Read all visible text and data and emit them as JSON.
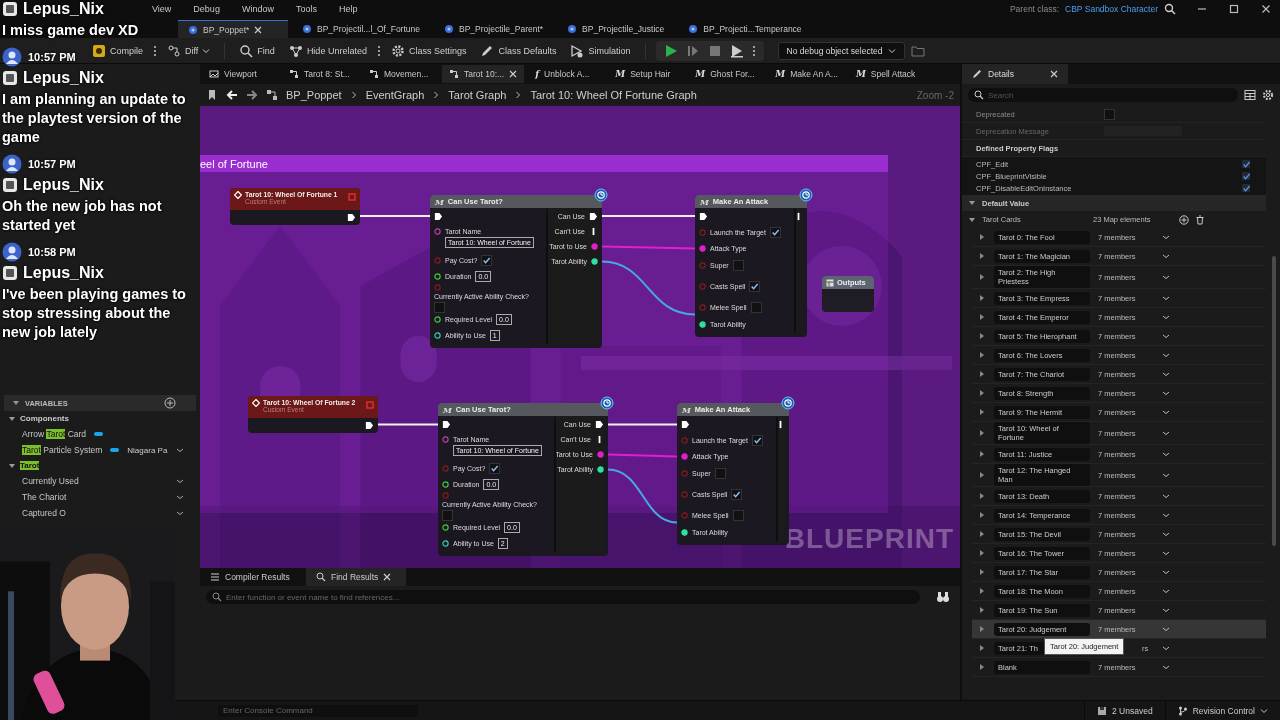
{
  "menu": {
    "items": [
      "View",
      "Debug",
      "Window",
      "Tools",
      "Help"
    ],
    "parent_class_label": "Parent class:",
    "parent_class": "CBP Sandbox Character"
  },
  "doc_tabs": [
    {
      "label": "BP_Poppet*",
      "selected": true
    },
    {
      "label": "BP_Projectil...l_Of_Fortune",
      "selected": false
    },
    {
      "label": "BP_Projectile_Parent*",
      "selected": false
    },
    {
      "label": "BP_Projectile_Justice",
      "selected": false
    },
    {
      "label": "BP_Projecti...Temperance",
      "selected": false
    }
  ],
  "toolbar": {
    "items": [
      "Compile",
      "Diff",
      "Find",
      "Hide Unrelated",
      "Class Settings",
      "Class Defaults",
      "Simulation"
    ],
    "debug_object": "No debug object selected"
  },
  "graph_tabs": [
    {
      "label": "Viewport",
      "selected": false
    },
    {
      "label": "Tarot 8: St...",
      "selected": false
    },
    {
      "label": "Movemen...",
      "selected": false
    },
    {
      "label": "Tarot 10:...",
      "selected": true
    },
    {
      "label": "Unblock A...",
      "glyph": "f",
      "selected": false
    },
    {
      "label": "Setup Hair",
      "glyph": "M",
      "selected": false
    },
    {
      "label": "Ghost For...",
      "glyph": "M",
      "selected": false
    },
    {
      "label": "Make An A...",
      "glyph": "M",
      "selected": false
    },
    {
      "label": "Spell Attack",
      "glyph": "M",
      "selected": false
    }
  ],
  "breadcrumb": [
    "BP_Poppet",
    "EventGraph",
    "Tarot Graph",
    "Tarot 10: Wheel Of Fortune Graph"
  ],
  "zoom": "Zoom -2",
  "graph": {
    "comment_title": "eel of Fortune",
    "label": "BLUEPRINT",
    "nodes": [
      {
        "kind": "event",
        "title": "Tarot 10: Wheel Of Fortune 1",
        "subtitle": "Custom Event",
        "outputs": [
          {
            "kind": "exec",
            "linked": true
          }
        ]
      },
      {
        "kind": "function",
        "glyph": "M",
        "title": "Can Use Tarot?",
        "inputs": [
          {
            "kind": "exec",
            "linked": true
          },
          {
            "kind": "name",
            "label": "Tarot Name",
            "value": "Tarot 10: Wheel of Fortune",
            "linked": false
          },
          {
            "kind": "bool",
            "label": "Pay Cost?",
            "checked": true,
            "linked": false
          },
          {
            "kind": "float",
            "label": "Duration",
            "value": "0.0",
            "linked": false
          },
          {
            "kind": "bool",
            "label": "Currently Active Ability Check?",
            "checked": false,
            "linked": false
          },
          {
            "kind": "float",
            "label": "Required Level",
            "value": "0.0",
            "linked": false
          },
          {
            "kind": "int",
            "label": "Ability to Use",
            "value": "1",
            "linked": false
          }
        ],
        "outputs": [
          {
            "kind": "exec",
            "label": "Can Use",
            "linked": true
          },
          {
            "kind": "exec",
            "label": "Can't Use",
            "linked": false
          },
          {
            "kind": "enum",
            "label": "Tarot to Use",
            "linked": true
          },
          {
            "kind": "struct",
            "label": "Tarot Ability",
            "linked": true
          }
        ]
      },
      {
        "kind": "function",
        "glyph": "M",
        "title": "Make An Attack",
        "inputs": [
          {
            "kind": "exec",
            "linked": true
          },
          {
            "kind": "bool",
            "label": "Launch the Target",
            "checked": true,
            "linked": false
          },
          {
            "kind": "enum",
            "label": "Attack Type",
            "linked": true
          },
          {
            "kind": "bool",
            "label": "Super",
            "checked": false,
            "linked": false
          },
          {
            "kind": "bool",
            "label": "Casts Spell",
            "checked": true,
            "linked": false
          },
          {
            "kind": "bool",
            "label": "Melee Spell",
            "checked": false,
            "linked": false
          },
          {
            "kind": "struct",
            "label": "Tarot Ability",
            "linked": true
          }
        ],
        "outputs": [
          {
            "kind": "exec",
            "linked": false
          }
        ]
      },
      {
        "kind": "outputs",
        "title": "Outputs"
      },
      {
        "kind": "event",
        "title": "Tarot 10: Wheel Of Fortune 2",
        "subtitle": "Custom Event",
        "outputs": [
          {
            "kind": "exec",
            "linked": true
          }
        ]
      },
      {
        "kind": "function",
        "glyph": "M",
        "title": "Can Use Tarot?",
        "inputs": [
          {
            "kind": "exec",
            "linked": true
          },
          {
            "kind": "name",
            "label": "Tarot Name",
            "value": "Tarot 10: Wheel of Fortune",
            "linked": false
          },
          {
            "kind": "bool",
            "label": "Pay Cost?",
            "checked": true,
            "linked": false
          },
          {
            "kind": "float",
            "label": "Duration",
            "value": "0.0",
            "linked": false
          },
          {
            "kind": "bool",
            "label": "Currently Active Ability Check?",
            "checked": false,
            "linked": false
          },
          {
            "kind": "float",
            "label": "Required Level",
            "value": "0.0",
            "linked": false
          },
          {
            "kind": "int",
            "label": "Ability to Use",
            "value": "2",
            "linked": false
          }
        ],
        "outputs": [
          {
            "kind": "exec",
            "label": "Can Use",
            "linked": true
          },
          {
            "kind": "exec",
            "label": "Can't Use",
            "linked": false
          },
          {
            "kind": "enum",
            "label": "Tarot to Use",
            "linked": true
          },
          {
            "kind": "struct",
            "label": "Tarot Ability",
            "linked": true
          }
        ]
      },
      {
        "kind": "function",
        "glyph": "M",
        "title": "Make An Attack",
        "inputs": [
          {
            "kind": "exec",
            "linked": true
          },
          {
            "kind": "bool",
            "label": "Launch the Target",
            "checked": true,
            "linked": false
          },
          {
            "kind": "enum",
            "label": "Attack Type",
            "linked": true
          },
          {
            "kind": "bool",
            "label": "Super",
            "checked": false,
            "linked": false
          },
          {
            "kind": "bool",
            "label": "Casts Spell",
            "checked": true,
            "linked": false
          },
          {
            "kind": "bool",
            "label": "Melee Spell",
            "checked": false,
            "linked": false
          },
          {
            "kind": "struct",
            "label": "Tarot Ability",
            "linked": true
          }
        ],
        "outputs": [
          {
            "kind": "exec",
            "linked": false
          }
        ]
      }
    ]
  },
  "bottom_panel": {
    "tabs": [
      {
        "label": "Compiler Results",
        "selected": false
      },
      {
        "label": "Find Results",
        "selected": true
      }
    ],
    "search_placeholder": "Enter function or event name to find references..."
  },
  "console_placeholder": "Enter Console Command",
  "status": {
    "unsaved": "2 Unsaved",
    "revision": "Revision Control"
  },
  "chat": [
    {
      "name": "Lepus_Nix",
      "text": "I miss game dev XD"
    },
    {
      "time": "10:57 PM",
      "name": "Lepus_Nix",
      "text": "I am planning an update to the playtest version of the game"
    },
    {
      "time": "10:57 PM",
      "name": "Lepus_Nix",
      "text": "Oh the new job has not started yet"
    },
    {
      "time": "10:58 PM",
      "name": "Lepus_Nix",
      "text": "I've been playing games to stop stressing about the new job lately"
    }
  ],
  "variables": {
    "header": "VARIABLES",
    "categories": [
      {
        "parts": [
          {
            "text": "Components",
            "match": false
          }
        ],
        "items": [
          {
            "kind": "component",
            "parts": [
              {
                "text": "Arrow ",
                "match": false
              },
              {
                "text": "Tarot",
                "match": true
              },
              {
                "text": " Card",
                "match": false
              }
            ]
          },
          {
            "kind": "component",
            "parts": [
              {
                "text": "Tarot",
                "match": true
              },
              {
                "text": " Particle System",
                "match": false
              }
            ],
            "type_text": "Niagara Pa"
          }
        ]
      },
      {
        "parts": [
          {
            "text": "Tarot",
            "match": true
          }
        ],
        "items": [
          {
            "kind": "variable",
            "parts": [
              {
                "text": "Currently Used",
                "match": false
              }
            ]
          },
          {
            "kind": "variable",
            "parts": [
              {
                "text": "The Chariot",
                "match": false
              }
            ]
          },
          {
            "kind": "variable",
            "parts": [
              {
                "text": "Captured O",
                "match": false
              }
            ]
          }
        ]
      }
    ]
  },
  "details": {
    "tab": "Details",
    "search_placeholder": "Search",
    "deprecated": {
      "label": "Deprecated",
      "checked": false
    },
    "deprecation_message": "Deprecation Message",
    "flags_header": "Defined Property Flags",
    "flags": [
      {
        "label": "CPF_Edit",
        "checked": true
      },
      {
        "label": "CPF_BlueprintVisible",
        "checked": true
      },
      {
        "label": "CPF_DisableEditOnInstance",
        "checked": true
      }
    ],
    "default_value": "Default Value",
    "map": {
      "label": "Tarot Cards",
      "count": "23 Map elements",
      "entries": [
        {
          "name": "Tarot 0: The Fool",
          "members": "7 members",
          "hovered": false
        },
        {
          "name": "Tarot 1: The Magician",
          "members": "7 members",
          "hovered": false
        },
        {
          "name": "Tarot 2: The High Priestess",
          "members": "7 members",
          "hovered": false
        },
        {
          "name": "Tarot 3: The Empress",
          "members": "7 members",
          "hovered": false
        },
        {
          "name": "Tarot 4: The Emperor",
          "members": "7 members",
          "hovered": false
        },
        {
          "name": "Tarot 5: The Hierophant",
          "members": "7 members",
          "hovered": false
        },
        {
          "name": "Tarot 6: The Lovers",
          "members": "7 members",
          "hovered": false
        },
        {
          "name": "Tarot 7: The Chariot",
          "members": "7 members",
          "hovered": false
        },
        {
          "name": "Tarot 8: Strength",
          "members": "7 members",
          "hovered": false
        },
        {
          "name": "Tarot 9: The Hermit",
          "members": "7 members",
          "hovered": false
        },
        {
          "name": "Tarot 10: Wheel of Fortune",
          "members": "7 members",
          "hovered": false
        },
        {
          "name": "Tarot 11: Justice",
          "members": "7 members",
          "hovered": false
        },
        {
          "name": "Tarot 12: The Hanged Man",
          "members": "7 members",
          "hovered": false
        },
        {
          "name": "Tarot 13: Death",
          "members": "7 members",
          "hovered": false
        },
        {
          "name": "Tarot 14: Temperance",
          "members": "7 members",
          "hovered": false
        },
        {
          "name": "Tarot 15: The Devil",
          "members": "7 members",
          "hovered": false
        },
        {
          "name": "Tarot 16: The Tower",
          "members": "7 members",
          "hovered": false
        },
        {
          "name": "Tarot 17: The Star",
          "members": "7 members",
          "hovered": false
        },
        {
          "name": "Tarot 18: The Moon",
          "members": "7 members",
          "hovered": false
        },
        {
          "name": "Tarot 19: The Sun",
          "members": "7 members",
          "hovered": false
        },
        {
          "name": "Tarot 20: Judgement",
          "members": "7 members",
          "hovered": true,
          "tooltip": "Tarot 20: Judgement"
        },
        {
          "name": "Tarot 21: Th",
          "members": "rs",
          "hovered": false
        },
        {
          "name": "Blank",
          "members": "7 members",
          "hovered": false
        }
      ]
    }
  }
}
